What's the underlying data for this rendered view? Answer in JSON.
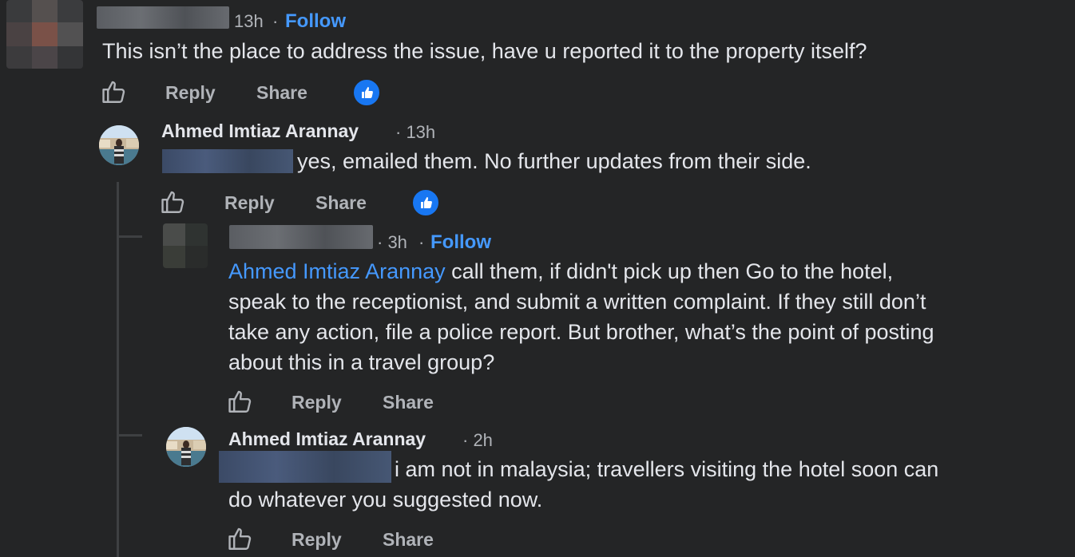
{
  "comment1": {
    "time": "13h",
    "dot": "·",
    "follow": "Follow",
    "text": "This isn’t the place to address the issue, have u reported it to the property itself?",
    "reply": "Reply",
    "share": "Share"
  },
  "reply1": {
    "author": "Ahmed Imtiaz Arannay",
    "time": "· 13h",
    "text": "yes, emailed them. No further updates from their side.",
    "reply": "Reply",
    "share": "Share"
  },
  "reply2": {
    "time": "· 3h",
    "dot": "·",
    "follow": "Follow",
    "mention": "Ahmed Imtiaz Arannay",
    "text_line1": " call them, if didn't pick up then Go to the hotel,",
    "text_line2": "speak to the receptionist, and submit a written complaint. If they still don’t",
    "text_line3": "take any action, file a police report. But brother, what’s the point of posting",
    "text_line4": "about this in a travel group?",
    "reply": "Reply",
    "share": "Share"
  },
  "reply3": {
    "author": "Ahmed Imtiaz Arannay",
    "time": "· 2h",
    "text_line1": "i am not in malaysia; travellers visiting the hotel soon can",
    "text_line2": "do whatever you suggested now.",
    "reply": "Reply",
    "share": "Share"
  },
  "icons": {
    "like": "thumbs-up-outline-icon",
    "reaction": "like-reaction-icon"
  },
  "colors": {
    "background": "#242526",
    "text": "#e4e6eb",
    "secondary": "#b0b3b8",
    "link": "#4599ff",
    "reaction": "#1877f2"
  }
}
